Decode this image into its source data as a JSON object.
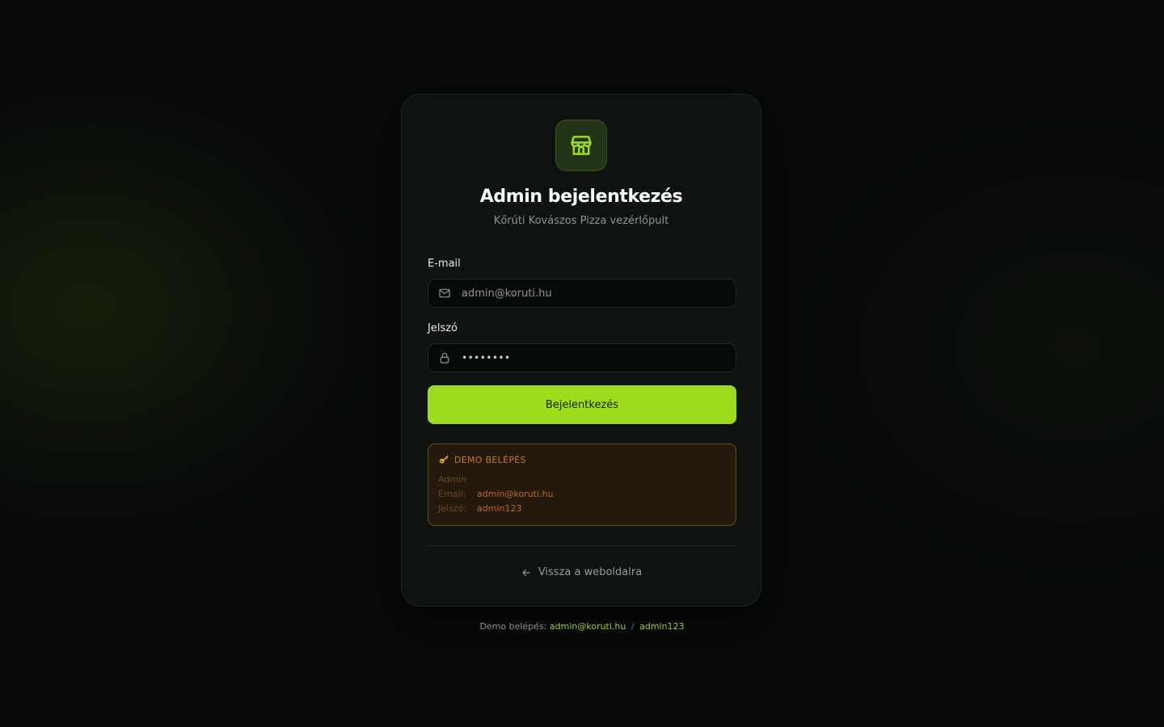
{
  "brand": {
    "icon": "store-icon",
    "accent_color": "#9ddc1a"
  },
  "header": {
    "title": "Admin bejelentkezés",
    "subtitle": "Kőrúti Kovászos Pizza vezérlőpult"
  },
  "form": {
    "email": {
      "label": "E-mail",
      "icon": "mail-icon",
      "placeholder": "admin@koruti.hu"
    },
    "password": {
      "label": "Jelszó",
      "icon": "lock-icon",
      "value_mask": "••••••••"
    },
    "submit_label": "Bejelentkezés"
  },
  "demo": {
    "heading": "DEMO BELÉPÉS",
    "icon": "key-icon",
    "role": "Admin",
    "email_key": "Email:",
    "email_value": "admin@koruti.hu",
    "password_key": "Jelszó:",
    "password_value": "admin123"
  },
  "back_link": {
    "icon": "arrow-left-icon",
    "label": "Vissza a weboldalra"
  },
  "footer": {
    "prefix": "Demo belépés:",
    "email": "admin@koruti.hu",
    "separator": "/",
    "password": "admin123"
  }
}
